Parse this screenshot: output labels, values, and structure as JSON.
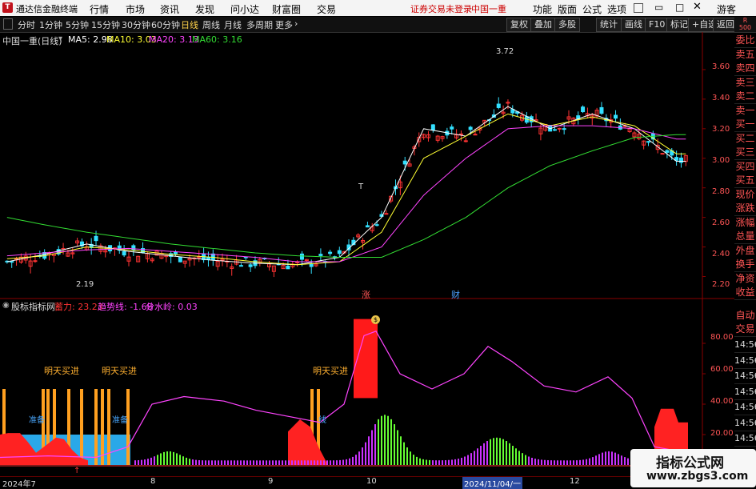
{
  "titlebar": {
    "app_title": "通达信金融终端",
    "menus": [
      "行情",
      "市场",
      "资讯",
      "发现",
      "问小达",
      "财富圈",
      "交易"
    ],
    "notice": "证券交易未登录",
    "stock": "中国一重",
    "right_menus": [
      "功能",
      "版面",
      "公式",
      "选项"
    ],
    "guest": "游客"
  },
  "toolbar": {
    "periods": [
      "分时",
      "1分钟",
      "5分钟",
      "15分钟",
      "30分钟",
      "60分钟",
      "日线",
      "周线",
      "月线",
      "多周期",
      "更多"
    ],
    "active_period": "日线",
    "buttons": [
      "复权",
      "叠加",
      "多股",
      "统计",
      "画线",
      "F10",
      "标记",
      "+自选",
      "返回"
    ]
  },
  "main_chart": {
    "stock_label": "中国一重(日线)",
    "ma_labels": [
      {
        "text": "MA5: 2.98",
        "color": "#ffffff"
      },
      {
        "text": "MA10: 3.03",
        "color": "#ffff33"
      },
      {
        "text": "MA20: 3.13",
        "color": "#ff44ff"
      },
      {
        "text": "MA60: 3.16",
        "color": "#33dd33"
      }
    ],
    "price_ticks": [
      "3.60",
      "3.40",
      "3.20",
      "3.00",
      "2.80",
      "2.60",
      "2.40",
      "2.20"
    ],
    "high_label": "3.72",
    "low_label": "2.19",
    "markers": {
      "zhang": "涨",
      "cai": "财",
      "t": "T"
    }
  },
  "right_panel": [
    "委比",
    "卖五",
    "卖四",
    "卖三",
    "卖二",
    "卖一",
    "买一",
    "买二",
    "买三",
    "买四",
    "买五",
    "现价",
    "涨跌",
    "涨幅",
    "总量",
    "外盘",
    "换手",
    "净资",
    "收益"
  ],
  "right_panel_lower": [
    "自动",
    "交易"
  ],
  "right_times": [
    "14:56",
    "14:56",
    "14:56",
    "14:56",
    "14:56",
    "14:56",
    "14:56",
    "14:56"
  ],
  "right_corner": {
    "top": "R",
    "bottom": "500"
  },
  "indicator": {
    "name": "股标指标网",
    "values": [
      {
        "text": "蓄力: 23.23",
        "color": "#ff3333"
      },
      {
        "text": "趋势线: -1.68",
        "color": "#ff44ff"
      },
      {
        "text": "分水岭: 0.03",
        "color": "#ff44ff"
      }
    ],
    "y_ticks": [
      "80.00",
      "60.00",
      "40.00",
      "20.00"
    ],
    "annotations": [
      "明天买进",
      "明天买进",
      "明天买进"
    ],
    "prep_labels": [
      "准备",
      "准备",
      "线"
    ]
  },
  "date_axis": [
    "2024年7",
    "8",
    "9",
    "10",
    "2024/11/04/一",
    "12"
  ],
  "watermark": {
    "title": "指标公式网",
    "url": "www.zbgs3.com"
  },
  "chart_data": {
    "type": "line",
    "title": "中国一重(日线)",
    "x": [
      1,
      9,
      18,
      27,
      36,
      45,
      54,
      63,
      72,
      81,
      90,
      99,
      108,
      117,
      126,
      135,
      144
    ],
    "series": [
      {
        "name": "MA5",
        "values": [
          2.3,
          2.35,
          2.42,
          2.37,
          2.34,
          2.31,
          2.29,
          2.28,
          2.33,
          2.6,
          3.2,
          3.15,
          3.35,
          3.2,
          3.3,
          3.2,
          2.98
        ]
      },
      {
        "name": "MA10",
        "values": [
          2.32,
          2.34,
          2.4,
          2.38,
          2.35,
          2.33,
          2.3,
          2.28,
          2.3,
          2.5,
          3.0,
          3.15,
          3.3,
          3.22,
          3.28,
          3.22,
          3.03
        ]
      },
      {
        "name": "MA20",
        "values": [
          2.34,
          2.36,
          2.38,
          2.39,
          2.37,
          2.35,
          2.33,
          2.3,
          2.3,
          2.4,
          2.75,
          3.0,
          3.2,
          3.22,
          3.22,
          3.2,
          3.13
        ]
      },
      {
        "name": "MA60",
        "values": [
          2.6,
          2.55,
          2.5,
          2.46,
          2.42,
          2.39,
          2.36,
          2.34,
          2.33,
          2.33,
          2.45,
          2.6,
          2.8,
          2.95,
          3.05,
          3.14,
          3.16
        ]
      }
    ],
    "ylim": [
      2.1,
      3.8
    ]
  }
}
